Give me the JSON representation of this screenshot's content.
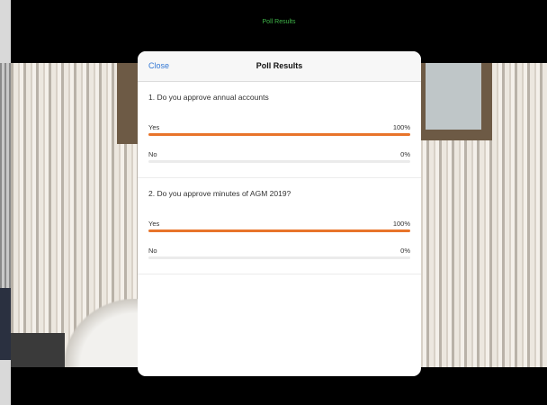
{
  "window": {
    "title": "Poll Results"
  },
  "modal": {
    "close_label": "Close",
    "title": "Poll Results",
    "questions": [
      {
        "text": "1. Do you approve annual accounts",
        "options": [
          {
            "label": "Yes",
            "percent_label": "100%",
            "percent": 100
          },
          {
            "label": "No",
            "percent_label": "0%",
            "percent": 0
          }
        ]
      },
      {
        "text": "2. Do you approve  minutes of AGM 2019?",
        "options": [
          {
            "label": "Yes",
            "percent_label": "100%",
            "percent": 100
          },
          {
            "label": "No",
            "percent_label": "0%",
            "percent": 0
          }
        ]
      }
    ]
  },
  "colors": {
    "accent": "#e8742a",
    "link": "#3478d4",
    "title_green": "#3fb649"
  }
}
